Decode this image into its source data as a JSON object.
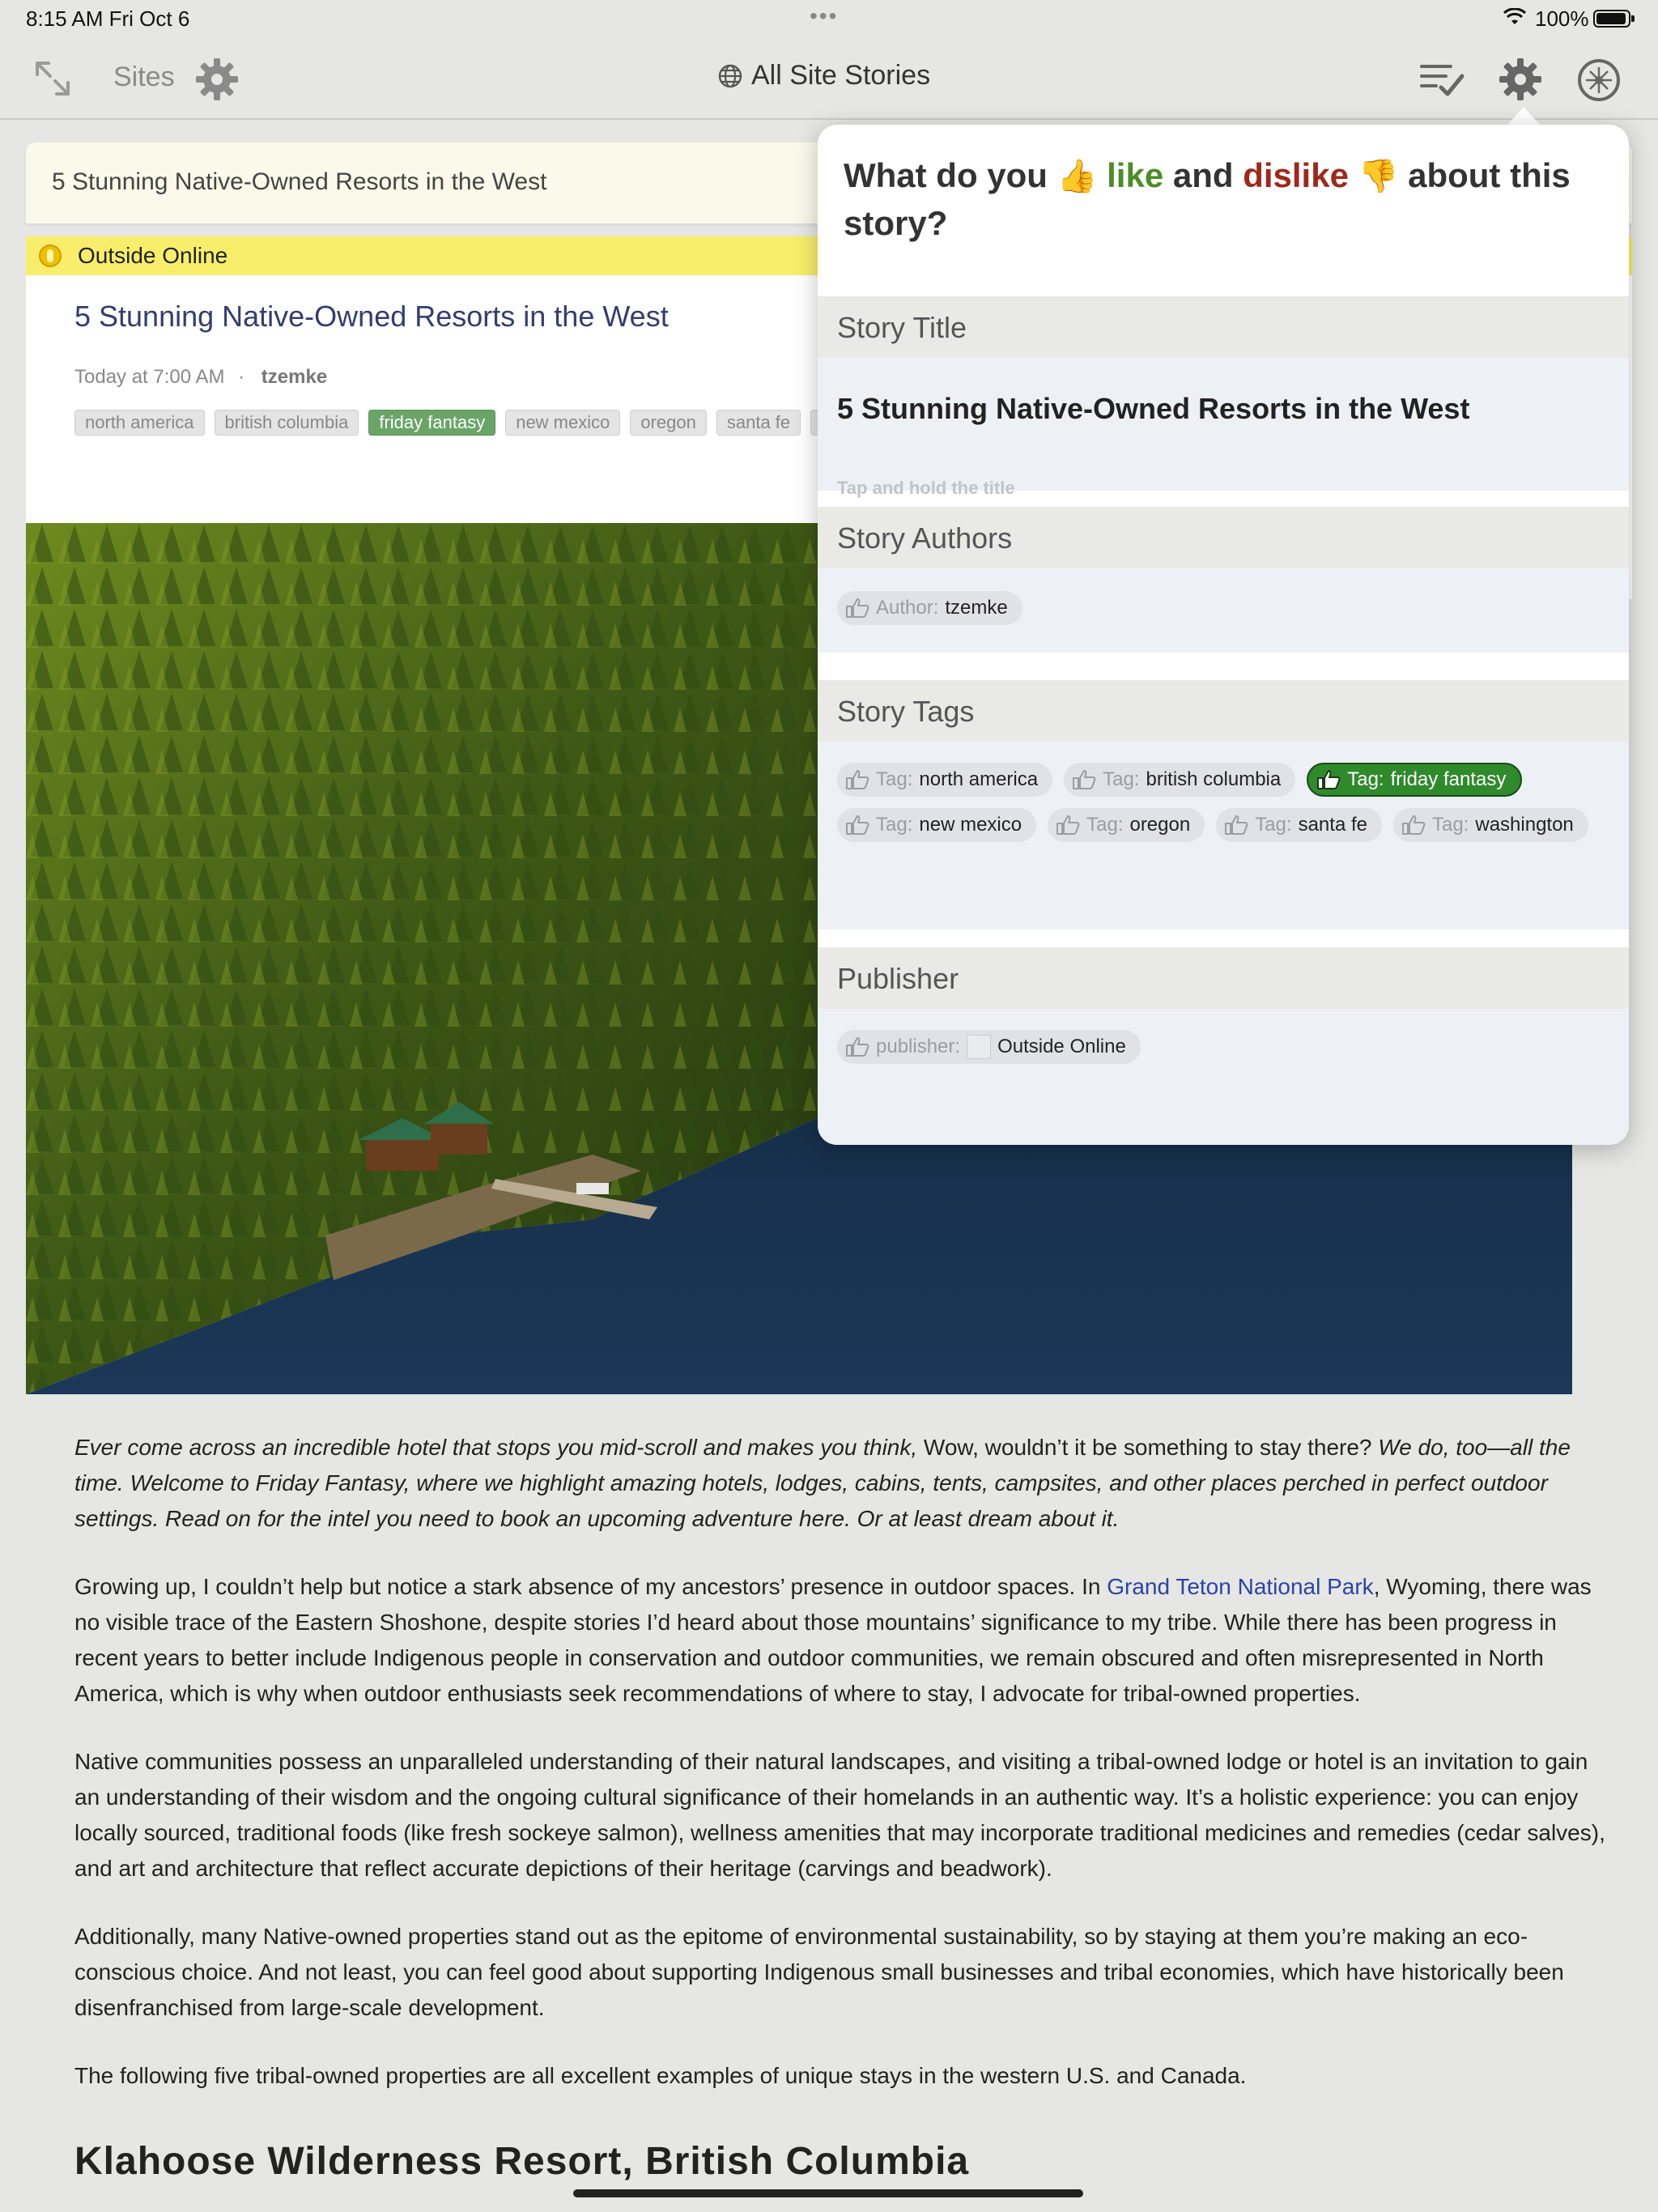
{
  "status_bar": {
    "time": "8:15 AM   Fri Oct 6",
    "dots": "•••",
    "battery": "100%"
  },
  "toolbar": {
    "sites_label": "Sites",
    "center_title": "All Site Stories"
  },
  "story_bar": {
    "title": "5 Stunning Native-Owned Resorts in the West"
  },
  "feed": {
    "name": "Outside Online"
  },
  "story": {
    "title": "5 Stunning Native-Owned Resorts in the West",
    "date": "Today at 7:00 AM",
    "separator": "·",
    "author": "tzemke",
    "tags": [
      {
        "label": "north america",
        "liked": false
      },
      {
        "label": "british columbia",
        "liked": false
      },
      {
        "label": "friday fantasy",
        "liked": true
      },
      {
        "label": "new mexico",
        "liked": false
      },
      {
        "label": "oregon",
        "liked": false
      },
      {
        "label": "santa fe",
        "liked": false
      },
      {
        "label": "wash",
        "liked": false
      }
    ]
  },
  "body": {
    "p1_italic_a": "Ever come across an incredible hotel that stops you mid-scroll and makes you think,",
    "p1_normal": " Wow, wouldn’t it be something to stay there? ",
    "p1_italic_b": "We do, too—all the time. Welcome to Friday Fantasy, where we highlight amazing hotels, lodges, cabins, tents, campsites, and other places perched in perfect outdoor settings. Read on for the intel you need to book an upcoming adventure here. Or at least dream about it.",
    "p2_a": "Growing up, I couldn’t help but notice a stark absence of my ancestors’ presence in outdoor spaces. In ",
    "p2_link": "Grand Teton National Park",
    "p2_b": ", Wyoming, there was no visible trace of the Eastern Shoshone, despite stories I’d heard about those mountains’ significance to my tribe. While there has been progress in recent years to better include Indigenous people in conservation and outdoor communities, we remain obscured and often misrepresented in North America, which is why when outdoor enthusiasts seek recommendations of where to stay, I advocate for tribal-owned properties.",
    "p3": "Native communities possess an unparalleled understanding of their natural landscapes, and visiting a tribal-owned lodge or hotel is an invitation to gain an understanding of their wisdom and the ongoing cultural significance of their homelands in an authentic way. It’s a holistic experience: you can enjoy locally sourced, traditional foods (like fresh sockeye salmon), wellness amenities that may incorporate traditional medicines and remedies (cedar salves), and art and architecture that reflect accurate depictions of their heritage (carvings and beadwork).",
    "p4": "Additionally, many Native-owned properties stand out as the epitome of environmental sustainability, so by staying at them you’re making an eco-conscious choice. And not least, you can feel good about supporting Indigenous small businesses and tribal economies, which have historically been disenfranchised from large-scale development.",
    "p5": "The following five tribal-owned properties are all excellent examples of unique stays in the western U.S. and Canada.",
    "next_heading": "Klahoose Wilderness Resort, British Columbia"
  },
  "trainer": {
    "q_prefix": "What do you",
    "q_like_emoji": "👍",
    "q_like": "like",
    "q_and": "and",
    "q_dislike": "dislike",
    "q_dislike_emoji": "👎",
    "q_suffix": "about this story?",
    "title_section": "Story Title",
    "title_value": "5 Stunning Native-Owned Resorts in the West",
    "title_hint": "Tap and hold the title",
    "authors_section": "Story Authors",
    "author_key": "Author:",
    "author_value": "tzemke",
    "tags_section": "Story Tags",
    "tag_key": "Tag:",
    "tags": [
      {
        "label": "north america",
        "liked": false
      },
      {
        "label": "british columbia",
        "liked": false
      },
      {
        "label": "friday fantasy",
        "liked": true
      },
      {
        "label": "new mexico",
        "liked": false
      },
      {
        "label": "oregon",
        "liked": false
      },
      {
        "label": "santa fe",
        "liked": false
      },
      {
        "label": "washington",
        "liked": false
      }
    ],
    "publisher_section": "Publisher",
    "publisher_key": "publisher:",
    "publisher_value": "Outside Online"
  },
  "colors": {
    "like": "#4b8d26",
    "dislike": "#a0281b",
    "feed_bar": "#f8ee6b",
    "liked_tag": "#6aa467",
    "liked_chip": "#2f8a2b"
  },
  "icons": [
    "expand-icon",
    "gear-icon",
    "globe-icon",
    "mark-read-icon",
    "compass-icon",
    "wifi-icon",
    "battery-icon",
    "thumbs-up-icon"
  ]
}
